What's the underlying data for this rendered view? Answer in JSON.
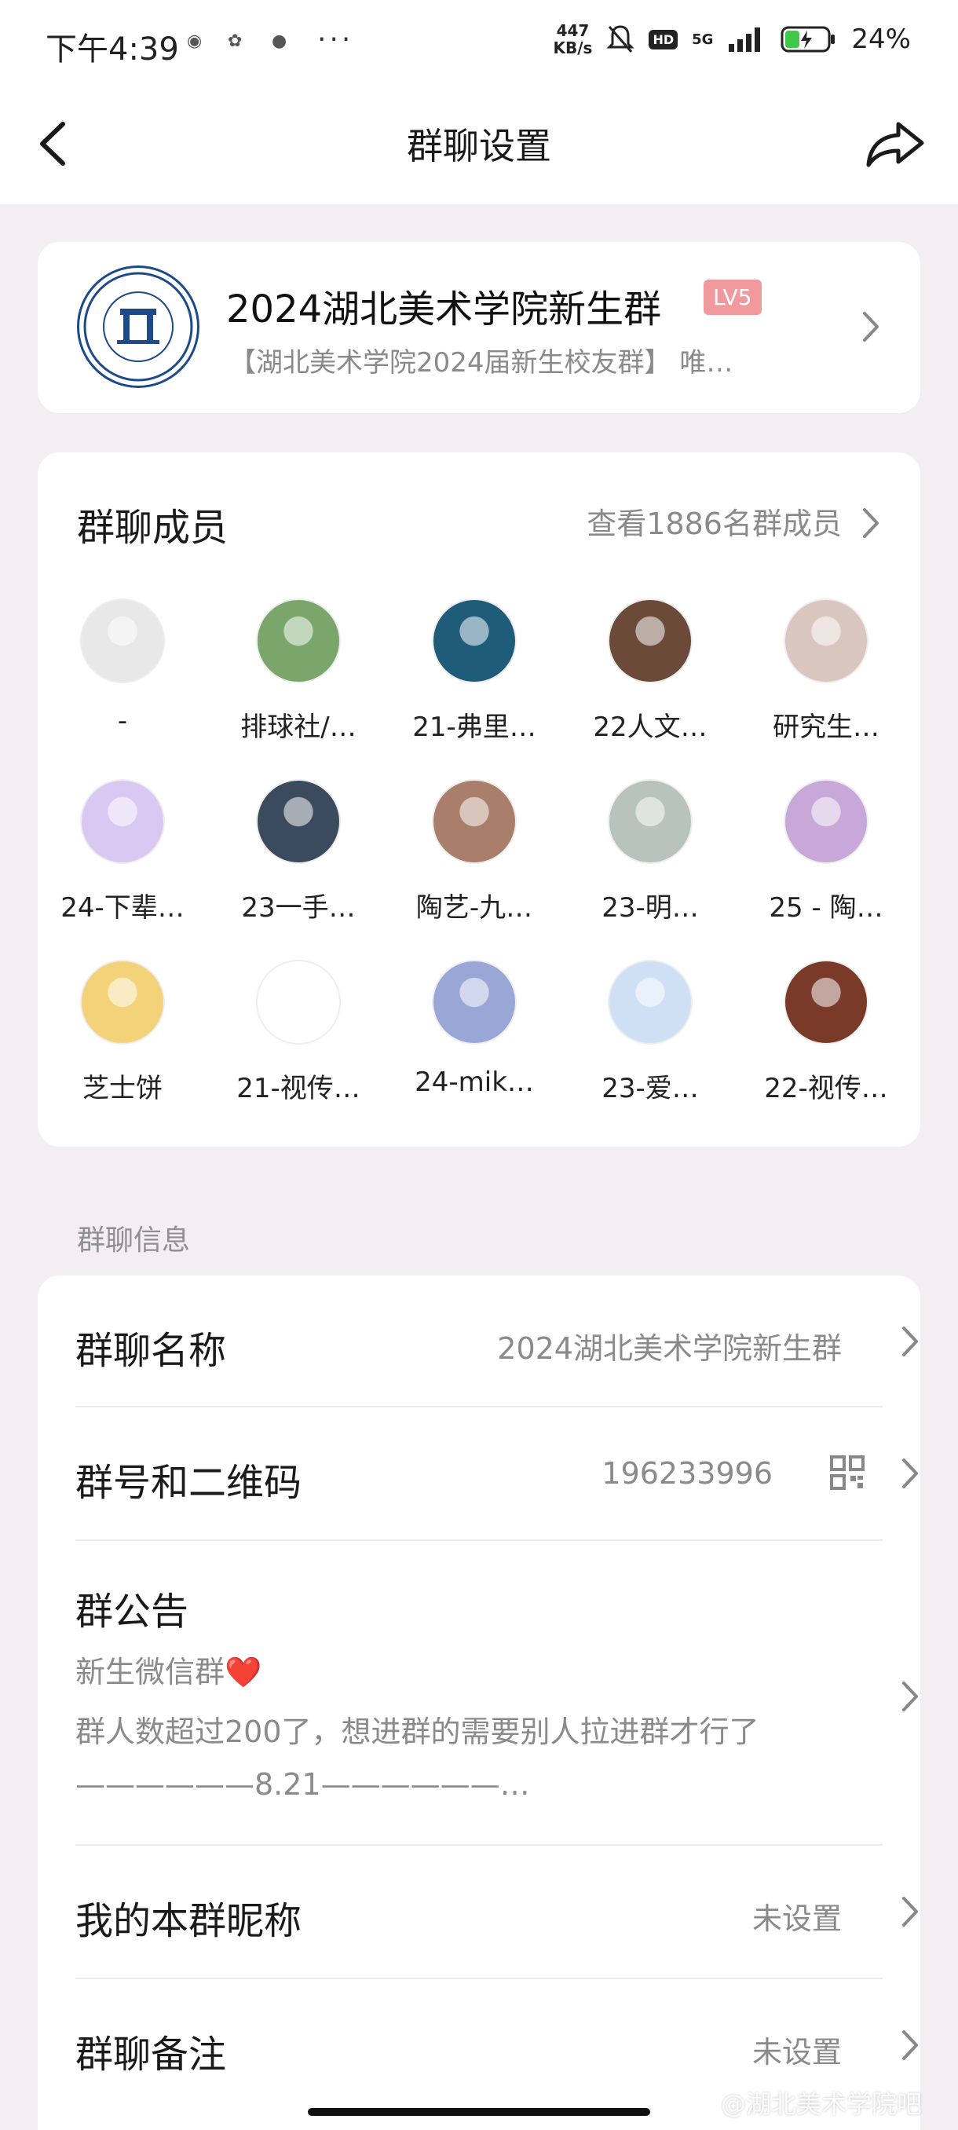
{
  "status_bar": {
    "time": "下午4:39",
    "net_speed_value": "447",
    "net_speed_unit": "KB/s",
    "hd": "HD",
    "signal": "5G",
    "battery": "24%",
    "more": "···"
  },
  "nav": {
    "title": "群聊设置"
  },
  "group": {
    "name": "2024湖北美术学院新生群",
    "level": "LV5",
    "description": "【湖北美术学院2024届新生校友群】 唯…"
  },
  "members": {
    "title": "群聊成员",
    "view_all": "查看1886名群成员",
    "items": [
      {
        "name": "-",
        "color": "#e8e8e8"
      },
      {
        "name": "排球社/…",
        "color": "#7aa66b"
      },
      {
        "name": "21-弗里…",
        "color": "#1f5c7a"
      },
      {
        "name": "22人文…",
        "color": "#6b4a3a"
      },
      {
        "name": "研究生…",
        "color": "#d9c7bf"
      },
      {
        "name": "24-下辈…",
        "color": "#d9c8f2"
      },
      {
        "name": "23一手…",
        "color": "#3b4a5c"
      },
      {
        "name": "陶艺-九…",
        "color": "#a97e6a"
      },
      {
        "name": "23-明…",
        "color": "#b9c3bd"
      },
      {
        "name": "25 - 陶…",
        "color": "#c8a8d8"
      },
      {
        "name": "芝士饼",
        "color": "#f3d27a"
      },
      {
        "name": "21-视传…",
        "color": "#ffffff"
      },
      {
        "name": "24-mik…",
        "color": "#9aa7d6"
      },
      {
        "name": "23-爱…",
        "color": "#cfe0f5"
      },
      {
        "name": "22-视传…",
        "color": "#7a3a2a"
      }
    ]
  },
  "info": {
    "section_label": "群聊信息",
    "group_name_label": "群聊名称",
    "group_name_value": "2024湖北美术学院新生群",
    "group_id_label": "群号和二维码",
    "group_id_value": "196233996",
    "notice_label": "群公告",
    "notice_line1": "新生微信群❤️",
    "notice_line2": "群人数超过200了，想进群的需要别人拉进群才行了",
    "notice_line3": "——————8.21——————…",
    "nickname_label": "我的本群昵称",
    "nickname_value": "未设置",
    "remark_label": "群聊备注",
    "remark_value": "未设置"
  },
  "watermark": "@湖北美术学院吧",
  "colors": {
    "background": "#f3eef2",
    "card": "#ffffff",
    "level_badge": "#f19a9e",
    "secondary_text": "#8a8a8a"
  }
}
